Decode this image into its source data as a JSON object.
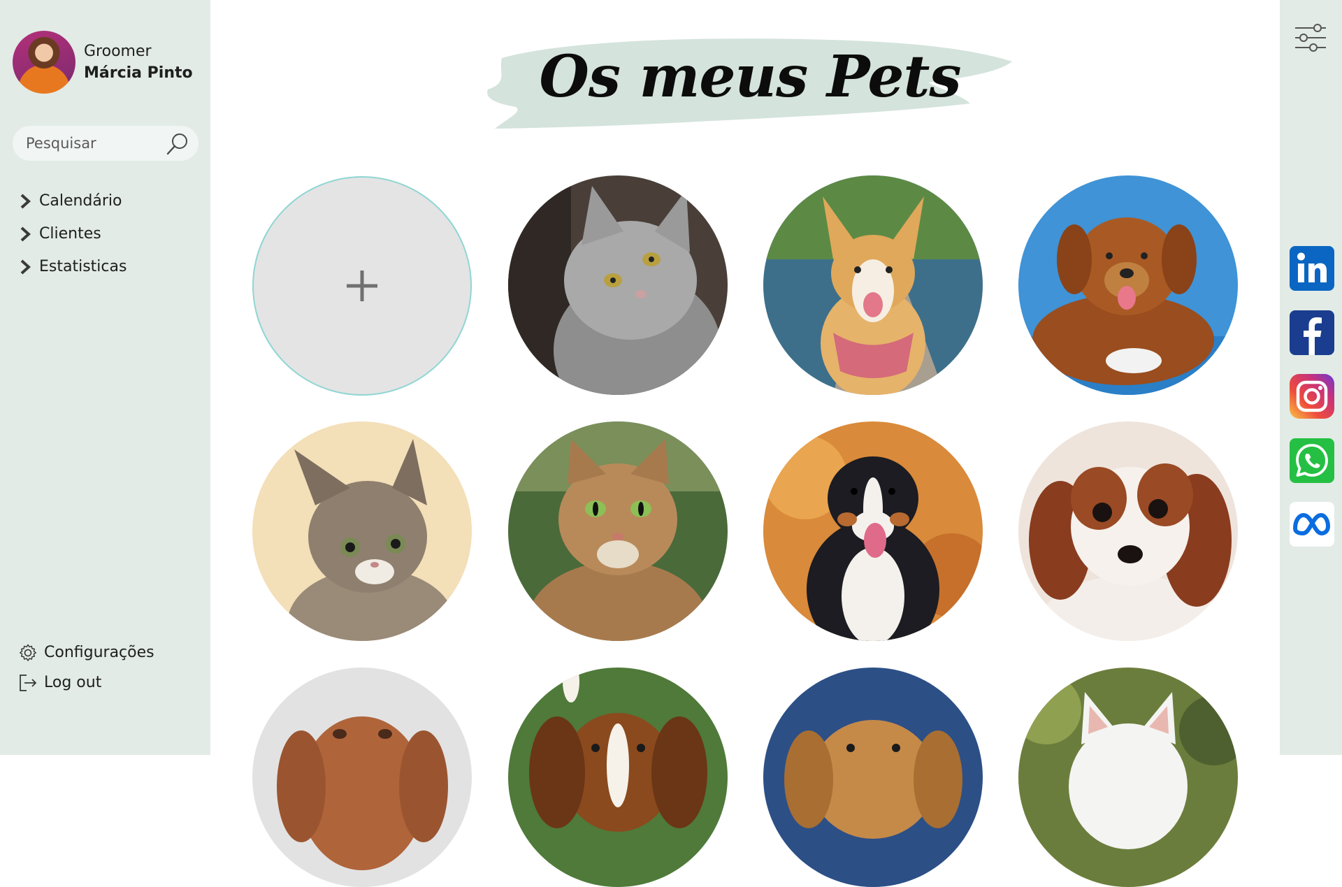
{
  "profile": {
    "role": "Groomer",
    "name": "Márcia Pinto"
  },
  "search": {
    "placeholder": "Pesquisar"
  },
  "nav": {
    "items": [
      {
        "label": "Calendário",
        "icon": "chevron-right-icon"
      },
      {
        "label": "Clientes",
        "icon": "chevron-right-icon"
      },
      {
        "label": "Estatisticas",
        "icon": "chevron-right-icon"
      }
    ]
  },
  "bottom_nav": {
    "settings_label": "Configurações",
    "logout_label": "Log out"
  },
  "main": {
    "title": "Os meus Pets",
    "add_pet_icon": "plus-icon",
    "pets": [
      {
        "kind": "cat-gray"
      },
      {
        "kind": "dog-corgi"
      },
      {
        "kind": "dog-brown"
      },
      {
        "kind": "cat-kitten"
      },
      {
        "kind": "cat-tabby"
      },
      {
        "kind": "dog-bernese"
      },
      {
        "kind": "dog-cavalier"
      },
      {
        "kind": "dog-vizsla"
      },
      {
        "kind": "dog-beagle"
      },
      {
        "kind": "dog-golden"
      },
      {
        "kind": "dog-white"
      }
    ]
  },
  "rightbar": {
    "filter_icon": "sliders-icon",
    "social": [
      "linkedin-icon",
      "facebook-icon",
      "instagram-icon",
      "whatsapp-icon",
      "meta-icon"
    ]
  },
  "colors": {
    "sidebar_bg": "#e2ebe6",
    "brush": "#d4e3dc",
    "add_circle_border": "#8fd6d3"
  }
}
